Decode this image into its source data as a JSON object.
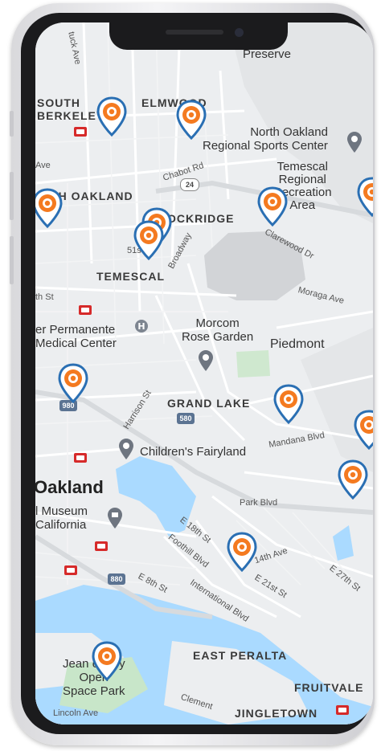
{
  "map": {
    "places": {
      "preserve": "Preserve",
      "al": "al",
      "south_berkeley": "SOUTH\nBERKELEY",
      "elmwood": "ELMWOOD",
      "north_oakland_sports": "North Oakland\nRegional Sports Center",
      "temescal_area": "Temescal\nRegional\nRecreation\nArea",
      "north_oakland": "RTH OAKLAND",
      "rockridge": "OCKRIDGE",
      "temescal": "TEMESCAL",
      "permanente": "er Permanente\nMedical Center",
      "morcom": "Morcom\nRose Garden",
      "piedmont": "Piedmont",
      "grand_lake": "GRAND LAKE",
      "fairyland": "Children's Fairyland",
      "oakland": "Oakland",
      "museum": "l Museum\nCalifornia",
      "east_peralta": "EAST PERALTA",
      "open_space": "Jean     eeney\nOpen\nSpace Park",
      "fruitvale": "FRUITVALE",
      "jingletown": "JINGLETOWN"
    },
    "streets": {
      "tuck": "tuck Ave",
      "ave": "Ave",
      "chabot": "Chabot Rd",
      "fifty_first": "51st St",
      "broadway": "Broadway",
      "clarewood": "Clarewood Dr",
      "moraga": "Moraga Ave",
      "th_st": "th St",
      "harrison": "Harrison St",
      "mandana": "Mandana Blvd",
      "park_blvd": "Park Blvd",
      "e18th": "E 18th St",
      "foothill": "Foothill Blvd",
      "fourteenth": "14th Ave",
      "e21st": "E 21st St",
      "e27th": "E 27th St",
      "e8th": "E 8th St",
      "international": "International Blvd",
      "lincoln": "Lincoln Ave",
      "clement": "Clement"
    },
    "highways": {
      "h24": "24",
      "h980": "980",
      "h580": "580",
      "h880": "880"
    },
    "pin_icon": "charging-station-pin-icon",
    "colors": {
      "pin_outline": "#2a6fb3",
      "pin_fill": "#f47a20",
      "water": "#aadaff",
      "park": "#c8e6c9",
      "road": "#ffffff",
      "land": "#eceef0"
    }
  }
}
